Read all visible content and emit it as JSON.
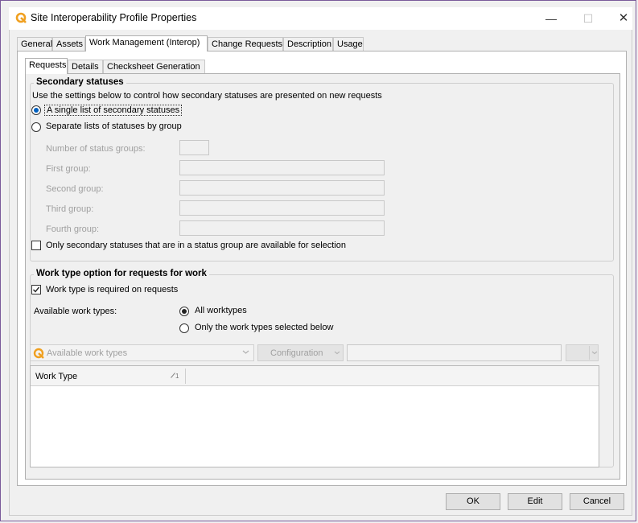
{
  "window": {
    "title": "Site Interoperability Profile Properties",
    "minimize": "—",
    "maximize": "☐",
    "close": "✕"
  },
  "tabs": [
    "General",
    "Assets",
    "Work Management (Interop)",
    "Change Requests",
    "Description",
    "Usage"
  ],
  "active_tab": "Work Management (Interop)",
  "subtabs": [
    "Requests",
    "Details",
    "Checksheet Generation"
  ],
  "active_subtab": "Requests",
  "secondary": {
    "title": "Secondary statuses",
    "description": "Use the settings below to control how secondary statuses are presented on new requests",
    "option_single": "A single list of secondary statuses",
    "option_separate": "Separate lists of statuses by group",
    "selected": "single",
    "num_groups_label": "Number of status groups:",
    "first_group_label": "First group:",
    "second_group_label": "Second group:",
    "third_group_label": "Third group:",
    "fourth_group_label": "Fourth group:",
    "only_in_group_label": "Only secondary statuses that are in a status group are available for selection",
    "only_in_group_checked": false
  },
  "worktype": {
    "title": "Work type option for requests for work",
    "required_label": "Work type is required on requests",
    "required_checked": true,
    "available_label": "Available work types:",
    "option_all": "All worktypes",
    "option_selected": "Only the work types selected below",
    "selected": "all",
    "dropdown_value": "Available work types",
    "config_button": "Configuration",
    "grid_column": "Work Type",
    "sort_indicator": "1"
  },
  "footer": {
    "ok": "OK",
    "edit": "Edit",
    "cancel": "Cancel"
  },
  "colors": {
    "accent": "#0060c0",
    "app_icon": "#f0a020"
  },
  "icons": {
    "app": "app-logo-icon",
    "dropdown": "chevron-down-icon",
    "sort": "sort-ascending-icon"
  }
}
